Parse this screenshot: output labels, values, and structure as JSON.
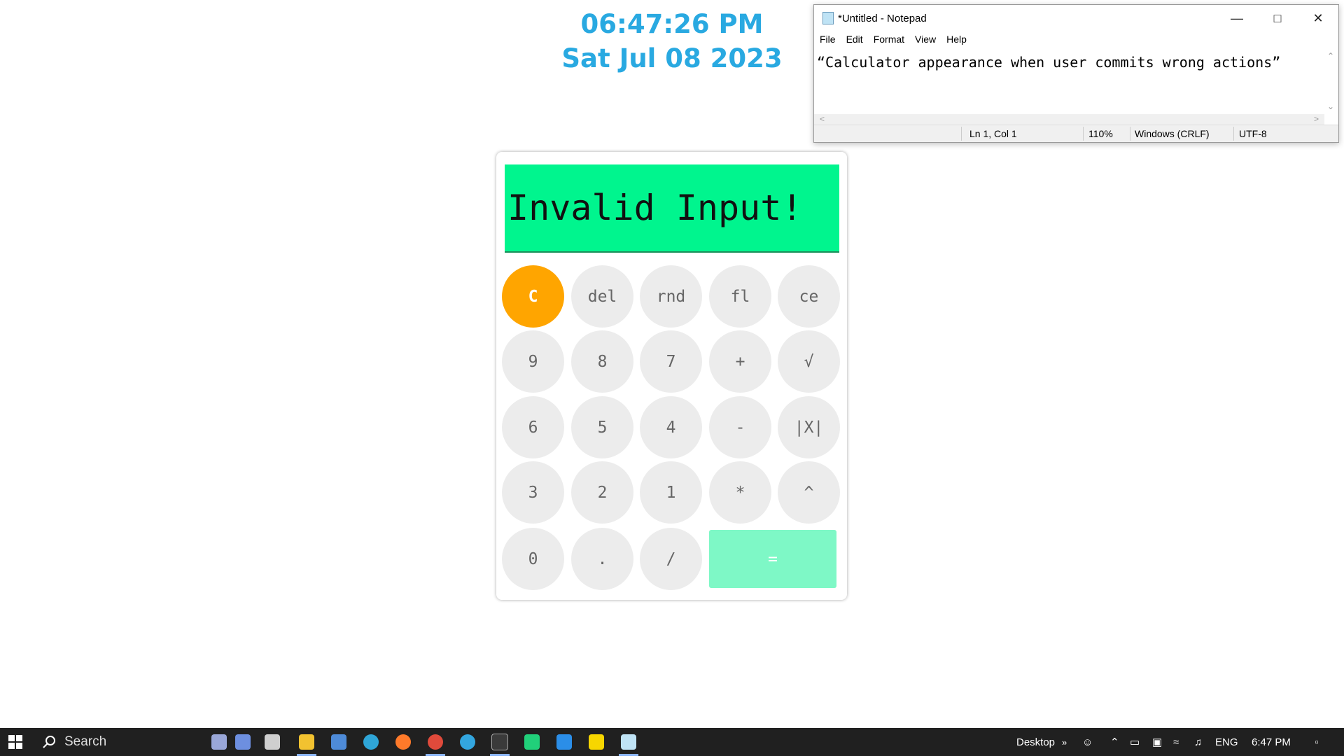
{
  "clock": {
    "time": "06:47:26 PM",
    "date": "Sat Jul 08 2023"
  },
  "calculator": {
    "display": "Invalid Input!",
    "rows": [
      [
        "C",
        "del",
        "rnd",
        "fl",
        "ce"
      ],
      [
        "9",
        "8",
        "7",
        "+",
        "√"
      ],
      [
        "6",
        "5",
        "4",
        "-",
        "|X|"
      ],
      [
        "3",
        "2",
        "1",
        "*",
        "^"
      ],
      [
        "0",
        ".",
        "/",
        "="
      ]
    ],
    "colors": {
      "display_bg": "#00f58e",
      "clear_bg": "#ffa500",
      "equals_bg": "#7ef8c6",
      "button_bg": "#ececec"
    }
  },
  "notepad": {
    "title": "*Untitled - Notepad",
    "menu": [
      "File",
      "Edit",
      "Format",
      "View",
      "Help"
    ],
    "content": "“Calculator appearance when user commits wrong actions”",
    "status": {
      "position": "Ln 1, Col 1",
      "zoom": "110%",
      "line_ending": "Windows (CRLF)",
      "encoding": "UTF-8"
    }
  },
  "taskbar": {
    "search_placeholder": "Search",
    "apps": [
      "game-controller-icon",
      "headset-icon",
      "task-view-icon",
      "file-explorer-icon",
      "microsoft-store-icon",
      "edge-icon",
      "firefox-icon",
      "chrome-icon",
      "telegram-icon",
      "terminal-icon",
      "pycharm-icon",
      "vscode-icon",
      "sticky-notes-icon",
      "notepad-icon"
    ],
    "desktop_label": "Desktop",
    "language": "ENG",
    "time": "6:47 PM"
  }
}
